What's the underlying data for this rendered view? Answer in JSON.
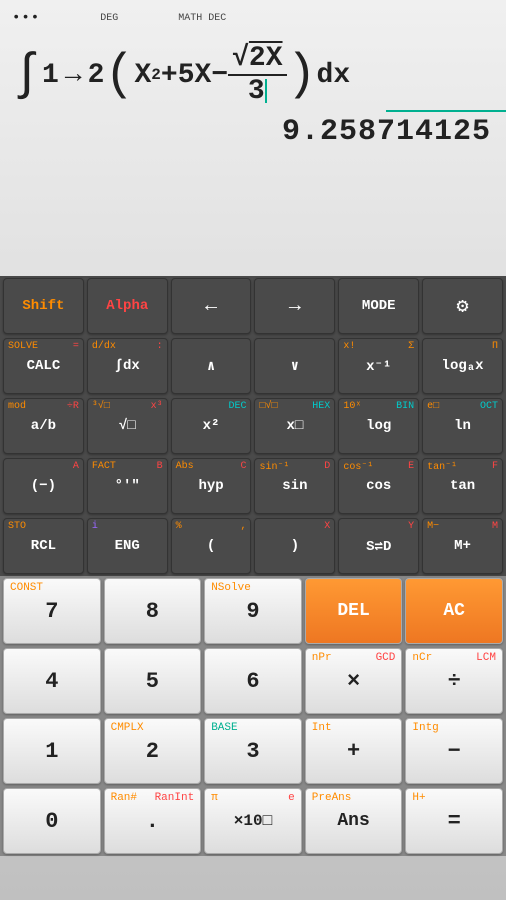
{
  "topbar": {
    "deg": "DEG",
    "mathdec": "MATH DEC"
  },
  "expression": {
    "int": "∫",
    "lb": "1",
    "arrow": "→",
    "ub": "2",
    "lbr": "(",
    "body1": "X",
    "sup1": "2",
    "body2": "+5X−",
    "sqrt": "√",
    "num": "2X",
    "den": "3",
    "rbr": ")",
    "dx": "dx"
  },
  "result": "9.258714125",
  "r1": {
    "shift": "Shift",
    "alpha": "Alpha",
    "left": "←",
    "right": "→",
    "mode": "MODE"
  },
  "r2": {
    "calc": {
      "m": "CALC",
      "tl": "SOLVE",
      "tr": "="
    },
    "intdx": {
      "m": "∫dx",
      "tl": "d/dx",
      "tr": ":"
    },
    "up": {
      "m": "∧"
    },
    "down": {
      "m": "∨"
    },
    "xinv": {
      "m": "x⁻¹",
      "tl": "x!",
      "tr": "Σ"
    },
    "log": {
      "m": "logₐx",
      "tr": "Π"
    }
  },
  "r3": {
    "ab": {
      "m": "a/b",
      "tl": "mod",
      "tr": "÷R"
    },
    "sqrt": {
      "m": "√□",
      "tl": "³√□",
      "tr": "x³"
    },
    "x2": {
      "m": "x²",
      "tr": "DEC"
    },
    "xn": {
      "m": "x□",
      "tl": "□√□",
      "tr": "HEX"
    },
    "loge": {
      "m": "log",
      "tl": "10ˣ",
      "tr": "BIN"
    },
    "ln": {
      "m": "ln",
      "tl": "e□",
      "tr": "OCT"
    }
  },
  "r4": {
    "neg": {
      "m": "(−)",
      "tr": "A"
    },
    "dms": {
      "m": "°'\"",
      "tl": "FACT",
      "tr": "B"
    },
    "hyp": {
      "m": "hyp",
      "tl": "Abs",
      "tr": "C"
    },
    "sin": {
      "m": "sin",
      "tl": "sin⁻¹",
      "tr": "D"
    },
    "cos": {
      "m": "cos",
      "tl": "cos⁻¹",
      "tr": "E"
    },
    "tan": {
      "m": "tan",
      "tl": "tan⁻¹",
      "tr": "F"
    }
  },
  "r5": {
    "rcl": {
      "m": "RCL",
      "tl": "STO"
    },
    "eng": {
      "m": "ENG",
      "tl": "i"
    },
    "lp": {
      "m": "(",
      "tl": "%",
      "tr": ","
    },
    "rp": {
      "m": ")",
      "tr": "X"
    },
    "sd": {
      "m": "S⇌D",
      "tr": "Y"
    },
    "mp": {
      "m": "M+",
      "tl": "M−",
      "tr": "M"
    }
  },
  "n1": {
    "7": {
      "m": "7",
      "tl": "CONST"
    },
    "8": {
      "m": "8"
    },
    "9": {
      "m": "9",
      "tl": "NSolve"
    },
    "del": {
      "m": "DEL"
    },
    "ac": {
      "m": "AC"
    }
  },
  "n2": {
    "4": {
      "m": "4"
    },
    "5": {
      "m": "5"
    },
    "6": {
      "m": "6"
    },
    "mul": {
      "m": "×",
      "tl": "nPr",
      "tr": "GCD"
    },
    "div": {
      "m": "÷",
      "tl": "nCr",
      "tr": "LCM"
    }
  },
  "n3": {
    "1": {
      "m": "1"
    },
    "2": {
      "m": "2",
      "tl": "CMPLX"
    },
    "3": {
      "m": "3",
      "tl": "BASE"
    },
    "add": {
      "m": "+",
      "tl": "Int"
    },
    "sub": {
      "m": "−",
      "tl": "Intg"
    }
  },
  "n4": {
    "0": {
      "m": "0"
    },
    "dot": {
      "m": ".",
      "tl": "Ran#",
      "tr": "RanInt"
    },
    "exp": {
      "m": "×10□",
      "tl": "π",
      "tr": "e"
    },
    "ans": {
      "m": "Ans",
      "tl": "PreAns"
    },
    "eq": {
      "m": "=",
      "tl": "H+"
    }
  }
}
